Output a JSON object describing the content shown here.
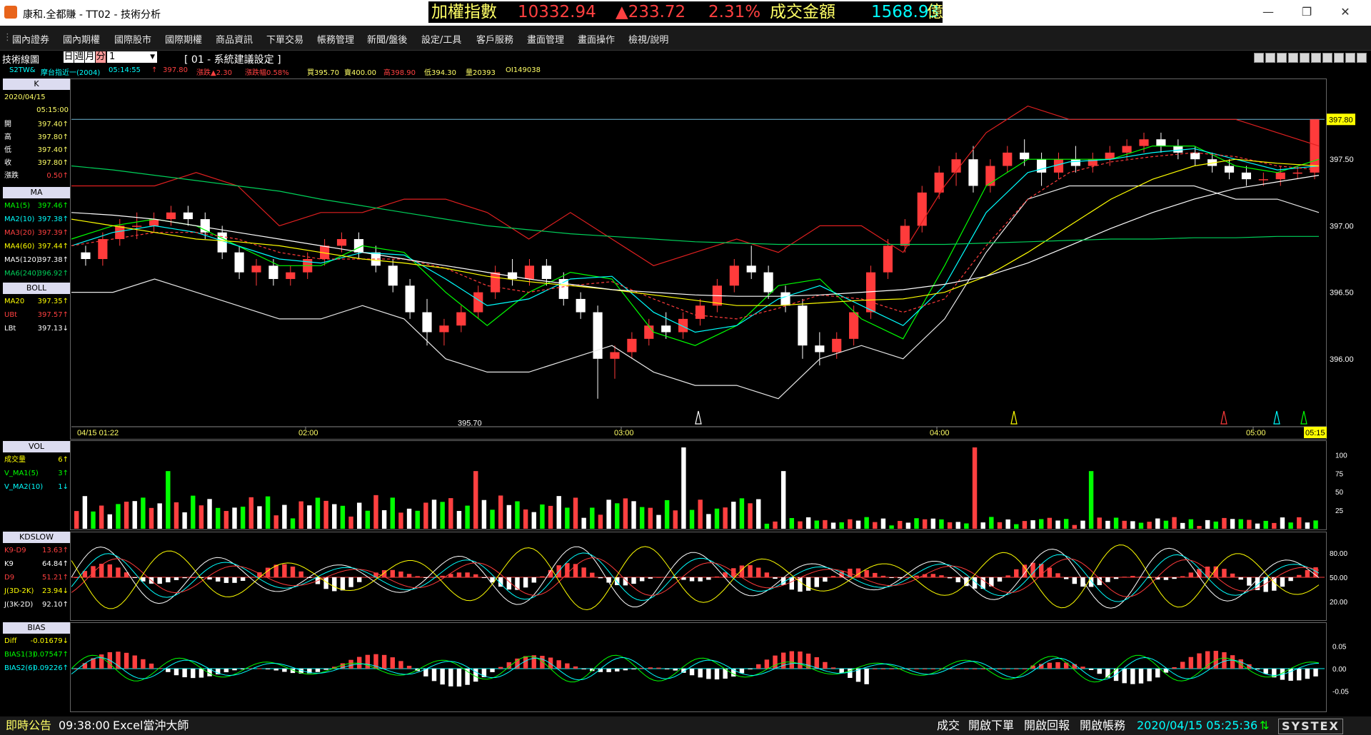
{
  "window": {
    "title": "康和.全都賺 - TT02 - 技術分析",
    "ticker": {
      "label": "加權指數",
      "value": "10332.94",
      "change": "▲233.72",
      "pct": "2.31%",
      "turnover_label": "成交金額",
      "turnover": "1568.93",
      "unit": "億"
    },
    "minimize_icon": "minimize-icon",
    "maximize_icon": "maximize-icon",
    "close_icon": "close-icon"
  },
  "menu": [
    "國內證券",
    "國內期權",
    "國際股市",
    "國際期權",
    "商品資訊",
    "下單交易",
    "帳務管理",
    "新聞/盤後",
    "設定/工具",
    "客戶服務",
    "畫面管理",
    "畫面操作",
    "檢視/說明"
  ],
  "toolbar": {
    "panel_name": "技術線圖",
    "periods": [
      "日",
      "週",
      "月",
      "分"
    ],
    "period_value": "1",
    "setting": "[ 01 - 系統建議設定 ]"
  },
  "quote": {
    "symbol": "S2TW&",
    "name": "摩台指近一(2004)",
    "time": "05:14:55",
    "arrow": "↑",
    "last": "397.80",
    "change": "漲跌▲2.30",
    "pct": "漲跌幅0.58%",
    "bid": "買395.70",
    "ask": "賣400.00",
    "high": "高398.90",
    "low": "低394.30",
    "vol": "量20393",
    "oi": "OI149038"
  },
  "colors": {
    "up": "#ff3b3b",
    "down": "#ffffff",
    "ma1": "#00ff00",
    "ma2": "#00ffff",
    "ma3": "#ff3b3b",
    "ma4": "#ffff00",
    "ma5": "#ffffff",
    "ma6": "#00d05a",
    "accent": "#ffff00"
  },
  "k_panel": {
    "header": "K",
    "date": "2020/04/15",
    "time": "05:15:00",
    "rows": [
      {
        "label": "開",
        "value": "397.40↑"
      },
      {
        "label": "高",
        "value": "397.80↑"
      },
      {
        "label": "低",
        "value": "397.40↑"
      },
      {
        "label": "收",
        "value": "397.80↑"
      },
      {
        "label": "漲跌",
        "value": "0.50↑"
      }
    ]
  },
  "ma_panel": {
    "header": "MA",
    "rows": [
      {
        "label": "MA1(5)",
        "value": "397.46↑",
        "color": "#00ff00"
      },
      {
        "label": "MA2(10)",
        "value": "397.38↑",
        "color": "#00ffff"
      },
      {
        "label": "MA3(20)",
        "value": "397.39↑",
        "color": "#ff3b3b"
      },
      {
        "label": "MA4(60)",
        "value": "397.44↑",
        "color": "#ffff00"
      },
      {
        "label": "MA5(120)",
        "value": "397.38↑",
        "color": "#ffffff"
      },
      {
        "label": "MA6(240)",
        "value": "396.92↑",
        "color": "#00d05a"
      }
    ]
  },
  "boll_panel": {
    "header": "BOLL",
    "rows": [
      {
        "label": "MA20",
        "value": "397.35↑",
        "color": "#ffff00"
      },
      {
        "label": "UBt",
        "value": "397.57↑",
        "color": "#ff3b3b"
      },
      {
        "label": "LBt",
        "value": "397.13↓",
        "color": "#ffffff"
      }
    ]
  },
  "vol_panel": {
    "header": "VOL",
    "rows": [
      {
        "label": "成交量",
        "value": "6↑",
        "color": "#ffff00"
      },
      {
        "label": "V_MA1(5)",
        "value": "3↑",
        "color": "#00ff00"
      },
      {
        "label": "V_MA2(10)",
        "value": "1↓",
        "color": "#00ffff"
      }
    ]
  },
  "kd_panel": {
    "header": "KDSLOW",
    "rows": [
      {
        "label": "K9-D9",
        "value": "13.63↑",
        "color": "#ff3b3b"
      },
      {
        "label": "K9",
        "value": "64.84↑",
        "color": "#ffffff"
      },
      {
        "label": "D9",
        "value": "51.21↑",
        "color": "#ff3b3b"
      },
      {
        "label": "J(3D-2K)",
        "value": "23.94↓",
        "color": "#ffff00"
      },
      {
        "label": "J(3K-2D)",
        "value": "92.10↑",
        "color": "#ffffff"
      }
    ]
  },
  "bias_panel": {
    "header": "BIAS",
    "rows": [
      {
        "label": "Diff",
        "value": "-0.01679↓",
        "color": "#ffff00"
      },
      {
        "label": "BIAS1(3)",
        "value": "0.07547↑",
        "color": "#00ff00"
      },
      {
        "label": "BIAS2(6)",
        "value": "0.09226↑",
        "color": "#00ffff"
      }
    ]
  },
  "chart_data": {
    "type": "candlestick",
    "x_ticks": [
      "04/15 01:22",
      "02:00",
      "03:00",
      "04:00",
      "05:00",
      "05:15"
    ],
    "y_ticks": [
      "397.50",
      "397.00",
      "396.50",
      "396.00"
    ],
    "last_price_label": "397.80",
    "low_label": "395.70",
    "ylim": [
      395.5,
      398.0
    ],
    "bars": [
      [
        396.8,
        396.85,
        396.7,
        396.75
      ],
      [
        396.75,
        396.95,
        396.7,
        396.9
      ],
      [
        396.9,
        397.05,
        396.85,
        397.0
      ],
      [
        397.0,
        397.1,
        396.9,
        397.0
      ],
      [
        397.0,
        397.1,
        396.95,
        397.05
      ],
      [
        397.05,
        397.15,
        397.0,
        397.1
      ],
      [
        397.1,
        397.15,
        397.0,
        397.05
      ],
      [
        397.05,
        397.1,
        396.9,
        396.95
      ],
      [
        396.95,
        397.0,
        396.75,
        396.8
      ],
      [
        396.8,
        396.85,
        396.6,
        396.65
      ],
      [
        396.65,
        396.75,
        396.55,
        396.7
      ],
      [
        396.7,
        396.75,
        396.55,
        396.6
      ],
      [
        396.6,
        396.7,
        396.55,
        396.65
      ],
      [
        396.65,
        396.8,
        396.6,
        396.75
      ],
      [
        396.75,
        396.9,
        396.7,
        396.85
      ],
      [
        396.85,
        396.95,
        396.8,
        396.9
      ],
      [
        396.9,
        396.95,
        396.75,
        396.8
      ],
      [
        396.8,
        396.85,
        396.65,
        396.7
      ],
      [
        396.7,
        396.75,
        396.5,
        396.55
      ],
      [
        396.55,
        396.6,
        396.3,
        396.35
      ],
      [
        396.35,
        396.45,
        396.1,
        396.2
      ],
      [
        396.2,
        396.3,
        396.1,
        396.25
      ],
      [
        396.25,
        396.4,
        396.2,
        396.35
      ],
      [
        396.35,
        396.55,
        396.3,
        396.5
      ],
      [
        396.5,
        396.7,
        396.45,
        396.65
      ],
      [
        396.65,
        396.75,
        396.55,
        396.6
      ],
      [
        396.6,
        396.75,
        396.55,
        396.7
      ],
      [
        396.7,
        396.75,
        396.55,
        396.6
      ],
      [
        396.6,
        396.65,
        396.4,
        396.45
      ],
      [
        396.45,
        396.5,
        396.3,
        396.35
      ],
      [
        396.35,
        396.4,
        395.7,
        396.0
      ],
      [
        396.0,
        396.1,
        395.85,
        396.05
      ],
      [
        396.05,
        396.2,
        396.0,
        396.15
      ],
      [
        396.15,
        396.3,
        396.1,
        396.25
      ],
      [
        396.25,
        396.35,
        396.15,
        396.2
      ],
      [
        396.2,
        396.35,
        396.15,
        396.3
      ],
      [
        396.3,
        396.45,
        396.25,
        396.4
      ],
      [
        396.4,
        396.6,
        396.35,
        396.55
      ],
      [
        396.55,
        396.75,
        396.5,
        396.7
      ],
      [
        396.7,
        396.85,
        396.6,
        396.65
      ],
      [
        396.65,
        396.7,
        396.45,
        396.5
      ],
      [
        396.5,
        396.55,
        396.35,
        396.4
      ],
      [
        396.4,
        396.45,
        396.0,
        396.1
      ],
      [
        396.1,
        396.2,
        395.95,
        396.05
      ],
      [
        396.05,
        396.2,
        396.0,
        396.15
      ],
      [
        396.15,
        396.4,
        396.1,
        396.35
      ],
      [
        396.35,
        396.7,
        396.3,
        396.65
      ],
      [
        396.65,
        396.9,
        396.6,
        396.85
      ],
      [
        396.85,
        397.05,
        396.8,
        397.0
      ],
      [
        397.0,
        397.3,
        396.95,
        397.25
      ],
      [
        397.25,
        397.45,
        397.2,
        397.4
      ],
      [
        397.4,
        397.55,
        397.3,
        397.5
      ],
      [
        397.5,
        397.6,
        397.25,
        397.3
      ],
      [
        397.3,
        397.5,
        397.25,
        397.45
      ],
      [
        397.45,
        397.6,
        397.4,
        397.55
      ],
      [
        397.55,
        397.65,
        397.45,
        397.5
      ],
      [
        397.5,
        397.55,
        397.3,
        397.4
      ],
      [
        397.4,
        397.55,
        397.35,
        397.5
      ],
      [
        397.5,
        397.6,
        397.4,
        397.45
      ],
      [
        397.45,
        397.55,
        397.4,
        397.5
      ],
      [
        397.5,
        397.6,
        397.45,
        397.55
      ],
      [
        397.55,
        397.65,
        397.5,
        397.6
      ],
      [
        397.6,
        397.7,
        397.55,
        397.65
      ],
      [
        397.65,
        397.7,
        397.55,
        397.6
      ],
      [
        397.6,
        397.65,
        397.5,
        397.55
      ],
      [
        397.55,
        397.6,
        397.45,
        397.5
      ],
      [
        397.5,
        397.55,
        397.4,
        397.45
      ],
      [
        397.45,
        397.5,
        397.35,
        397.4
      ],
      [
        397.4,
        397.45,
        397.3,
        397.35
      ],
      [
        397.35,
        397.4,
        397.3,
        397.35
      ],
      [
        397.35,
        397.45,
        397.3,
        397.4
      ],
      [
        397.4,
        397.45,
        397.35,
        397.4
      ],
      [
        397.4,
        397.8,
        397.35,
        397.8
      ]
    ],
    "ma_series": [
      {
        "name": "MA1(5)",
        "color": "#00ff00",
        "values": [
          396.9,
          397.0,
          397.05,
          397.0,
          396.85,
          396.7,
          396.7,
          396.85,
          396.8,
          396.5,
          396.25,
          396.5,
          396.65,
          396.6,
          396.2,
          396.1,
          396.25,
          396.55,
          396.6,
          396.3,
          396.15,
          396.7,
          397.3,
          397.5,
          397.5,
          397.5,
          397.6,
          397.6,
          397.45,
          397.4,
          397.5
        ]
      },
      {
        "name": "MA2(10)",
        "color": "#00ffff",
        "values": [
          396.85,
          396.95,
          397.0,
          396.95,
          396.85,
          396.75,
          396.72,
          396.8,
          396.78,
          396.6,
          396.4,
          396.45,
          396.6,
          396.62,
          396.35,
          396.2,
          396.25,
          396.45,
          396.55,
          396.4,
          396.25,
          396.55,
          397.1,
          397.4,
          397.48,
          397.5,
          397.55,
          397.58,
          397.5,
          397.42,
          397.45
        ]
      },
      {
        "name": "MA3(20)",
        "color": "#ff3b3b",
        "values": [
          396.85,
          396.9,
          396.95,
          396.95,
          396.9,
          396.8,
          396.75,
          396.75,
          396.75,
          396.68,
          396.55,
          396.5,
          396.55,
          396.58,
          396.45,
          396.33,
          396.3,
          396.38,
          396.48,
          396.45,
          396.35,
          396.45,
          396.85,
          397.2,
          397.4,
          397.48,
          397.52,
          397.55,
          397.52,
          397.45,
          397.42
        ]
      },
      {
        "name": "MA4(60)",
        "color": "#ffff00",
        "values": [
          397.05,
          397.0,
          396.95,
          396.9,
          396.88,
          396.85,
          396.8,
          396.75,
          396.72,
          396.68,
          396.62,
          396.58,
          396.55,
          396.52,
          396.48,
          396.44,
          396.4,
          396.4,
          396.42,
          396.44,
          396.45,
          396.5,
          396.62,
          396.8,
          397.0,
          397.2,
          397.35,
          397.45,
          397.5,
          397.47,
          397.45
        ]
      },
      {
        "name": "MA5(120)",
        "color": "#ffffff",
        "values": [
          397.1,
          397.08,
          397.05,
          397.0,
          396.95,
          396.9,
          396.85,
          396.8,
          396.75,
          396.7,
          396.65,
          396.6,
          396.56,
          396.52,
          396.5,
          396.48,
          396.47,
          396.47,
          396.48,
          396.5,
          396.52,
          396.56,
          396.62,
          396.72,
          396.85,
          396.98,
          397.1,
          397.2,
          397.28,
          397.33,
          397.38
        ]
      },
      {
        "name": "MA6(240)",
        "color": "#00d05a",
        "values": [
          397.45,
          397.42,
          397.38,
          397.34,
          397.3,
          397.26,
          397.2,
          397.15,
          397.1,
          397.05,
          397.0,
          396.97,
          396.94,
          396.92,
          396.9,
          396.88,
          396.87,
          396.86,
          396.86,
          396.86,
          396.86,
          396.86,
          396.87,
          396.88,
          396.89,
          396.9,
          396.9,
          396.91,
          396.91,
          396.92,
          396.92
        ]
      }
    ],
    "boll_upper": [
      397.3,
      397.3,
      397.3,
      397.4,
      397.3,
      397.0,
      397.1,
      397.1,
      397.2,
      397.2,
      397.1,
      396.9,
      397.1,
      396.9,
      396.7,
      396.8,
      396.9,
      396.8,
      397.0,
      397.0,
      396.8,
      397.3,
      397.7,
      397.9,
      397.8,
      397.8,
      397.8,
      397.8,
      397.8,
      397.7,
      397.6
    ],
    "boll_lower": [
      396.5,
      396.5,
      396.6,
      396.5,
      396.4,
      396.3,
      396.3,
      396.4,
      396.3,
      396.0,
      395.9,
      395.9,
      396.0,
      396.1,
      395.9,
      395.8,
      395.8,
      395.7,
      396.0,
      396.1,
      396.0,
      396.3,
      396.8,
      397.2,
      397.3,
      397.3,
      397.3,
      397.3,
      397.2,
      397.2,
      397.1
    ],
    "volume": {
      "y_ticks": [
        "100",
        "75",
        "50",
        "25"
      ],
      "ylim": [
        0,
        110
      ]
    },
    "kd": {
      "y_ticks": [
        "80.00",
        "50.00",
        "20.00"
      ],
      "ylim": [
        0,
        100
      ]
    },
    "bias": {
      "y_ticks": [
        "0.05",
        "0.00",
        "-0.05"
      ],
      "ylim": [
        -0.09,
        0.09
      ]
    }
  },
  "status": {
    "announce": "即時公告",
    "time": "09:38:00",
    "message": "Excel當沖大師",
    "buttons": [
      "成交",
      "開啟下單",
      "開啟回報",
      "開啟帳務"
    ],
    "datetime": "2020/04/15 05:25:36",
    "brand": "SYSTEX"
  }
}
